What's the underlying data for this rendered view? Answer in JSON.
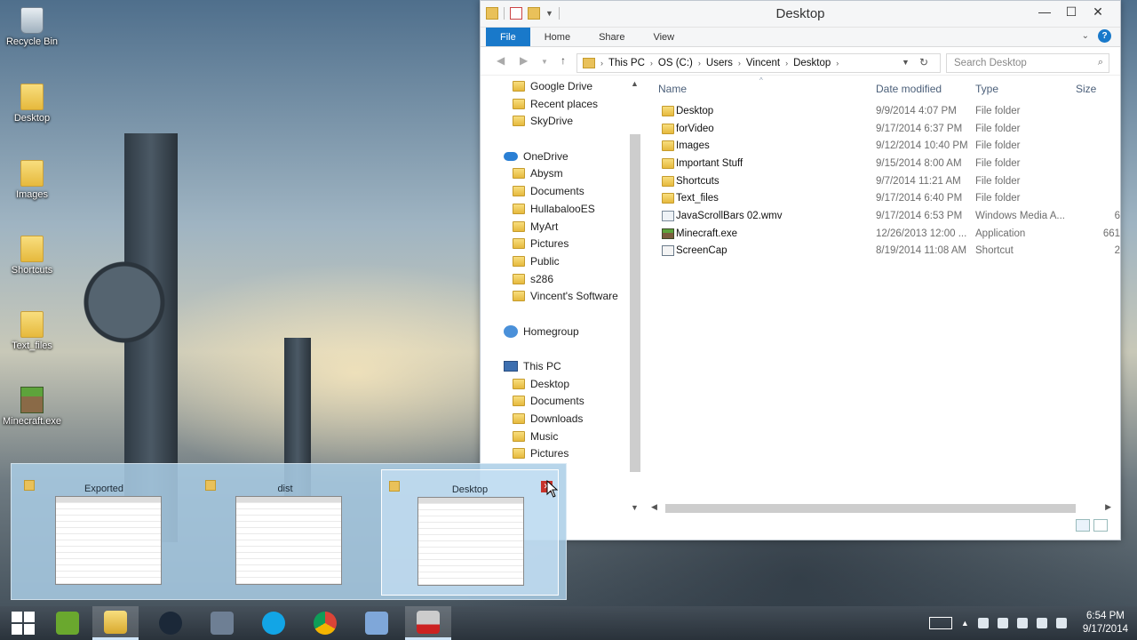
{
  "desktop": {
    "icons": [
      {
        "label": "Recycle Bin"
      },
      {
        "label": "Desktop"
      },
      {
        "label": "Images"
      },
      {
        "label": "Shortcuts"
      },
      {
        "label": "Text_files"
      },
      {
        "label": "Minecraft.exe"
      }
    ]
  },
  "window": {
    "title": "Desktop",
    "ribbon_tabs": [
      "File",
      "Home",
      "Share",
      "View"
    ],
    "address": [
      "This PC",
      "OS (C:)",
      "Users",
      "Vincent",
      "Desktop"
    ],
    "search_placeholder": "Search Desktop",
    "nav": {
      "quick": [
        "Google Drive",
        "Recent places",
        "SkyDrive"
      ],
      "onedrive_label": "OneDrive",
      "onedrive_items": [
        "Abysm",
        "Documents",
        "HullabalooES",
        "MyArt",
        "Pictures",
        "Public",
        "s286",
        "Vincent's Software"
      ],
      "homegroup_label": "Homegroup",
      "thispc_label": "This PC",
      "thispc_items": [
        "Desktop",
        "Documents",
        "Downloads",
        "Music",
        "Pictures"
      ]
    },
    "columns": {
      "name": "Name",
      "date": "Date modified",
      "type": "Type",
      "size": "Size"
    },
    "files": [
      {
        "name": "Desktop",
        "date": "9/9/2014 4:07 PM",
        "type": "File folder",
        "size": "",
        "icon": "folder-icon"
      },
      {
        "name": "forVideo",
        "date": "9/17/2014 6:37 PM",
        "type": "File folder",
        "size": "",
        "icon": "folder-icon"
      },
      {
        "name": "Images",
        "date": "9/12/2014 10:40 PM",
        "type": "File folder",
        "size": "",
        "icon": "folder-icon"
      },
      {
        "name": "Important Stuff",
        "date": "9/15/2014 8:00 AM",
        "type": "File folder",
        "size": "",
        "icon": "folder-icon"
      },
      {
        "name": "Shortcuts",
        "date": "9/7/2014 11:21 AM",
        "type": "File folder",
        "size": "",
        "icon": "folder-icon"
      },
      {
        "name": "Text_files",
        "date": "9/17/2014 6:40 PM",
        "type": "File folder",
        "size": "",
        "icon": "folder-icon"
      },
      {
        "name": "JavaScrollBars 02.wmv",
        "date": "9/17/2014 6:53 PM",
        "type": "Windows Media A...",
        "size": "6",
        "icon": "wmv-file-icon"
      },
      {
        "name": "Minecraft.exe",
        "date": "12/26/2013 12:00 ...",
        "type": "Application",
        "size": "661",
        "icon": "exe-file-icon"
      },
      {
        "name": "ScreenCap",
        "date": "8/19/2014 11:08 AM",
        "type": "Shortcut",
        "size": "2",
        "icon": "shortcut-file-icon"
      }
    ]
  },
  "thumbnails": [
    {
      "title": "Exported"
    },
    {
      "title": "dist"
    },
    {
      "title": "Desktop"
    }
  ],
  "taskbar": {
    "apps": [
      "start-icon",
      "xna-icon",
      "file-explorer-icon",
      "steam-icon",
      "app-icon",
      "skype-icon",
      "chrome-icon",
      "virtualbox-icon",
      "screen-recorder-icon"
    ],
    "time": "6:54 PM",
    "date": "9/17/2014"
  },
  "colors": {
    "accent": "#1979ca",
    "header_text": "#4c607a"
  }
}
